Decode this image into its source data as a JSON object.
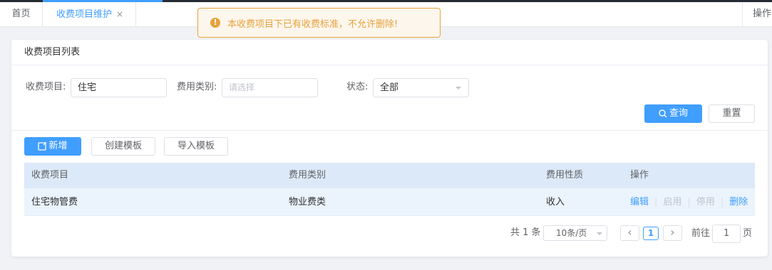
{
  "tabs": {
    "home_label": "首页",
    "active_label": "收费项目维护",
    "close_glyph": "×",
    "ops_label": "操作"
  },
  "alert": {
    "icon_glyph": "!",
    "message": "本收费项目下已有收费标准，不允许删除!"
  },
  "card": {
    "title": "收费项目列表"
  },
  "filters": {
    "item_label": "收费项目:",
    "item_value": "住宅",
    "category_label": "费用类别:",
    "category_placeholder": "请选择",
    "status_label": "状态:",
    "status_value": "全部"
  },
  "actions": {
    "search_label": "查询",
    "reset_label": "重置",
    "add_label": "新增",
    "create_template_label": "创建模板",
    "import_template_label": "导入模板"
  },
  "table": {
    "columns": [
      "收费项目",
      "费用类别",
      "费用性质",
      "操作"
    ],
    "rows": [
      {
        "item": "住宅物管费",
        "category": "物业费类",
        "nature": "收入",
        "ops": {
          "edit": "编辑",
          "enable": "启用",
          "disable": "停用",
          "delete": "删除",
          "sep": "|"
        }
      }
    ]
  },
  "pagination": {
    "total_text": "共 1 条",
    "page_size": "10条/页",
    "current_page": "1",
    "goto_label": "前往",
    "goto_value": "1",
    "page_suffix": "页",
    "prev_glyph": "‹",
    "next_glyph": "›"
  },
  "colors": {
    "accent": "#409eff",
    "warning": "#e6a23c",
    "header_bg": "#dce9f8",
    "row_bg": "#ebf3fc"
  },
  "icons": [
    "close-icon",
    "warning-icon",
    "search-icon",
    "add-icon",
    "dropdown-arrow-icon",
    "chevron-left-icon",
    "chevron-right-icon"
  ]
}
